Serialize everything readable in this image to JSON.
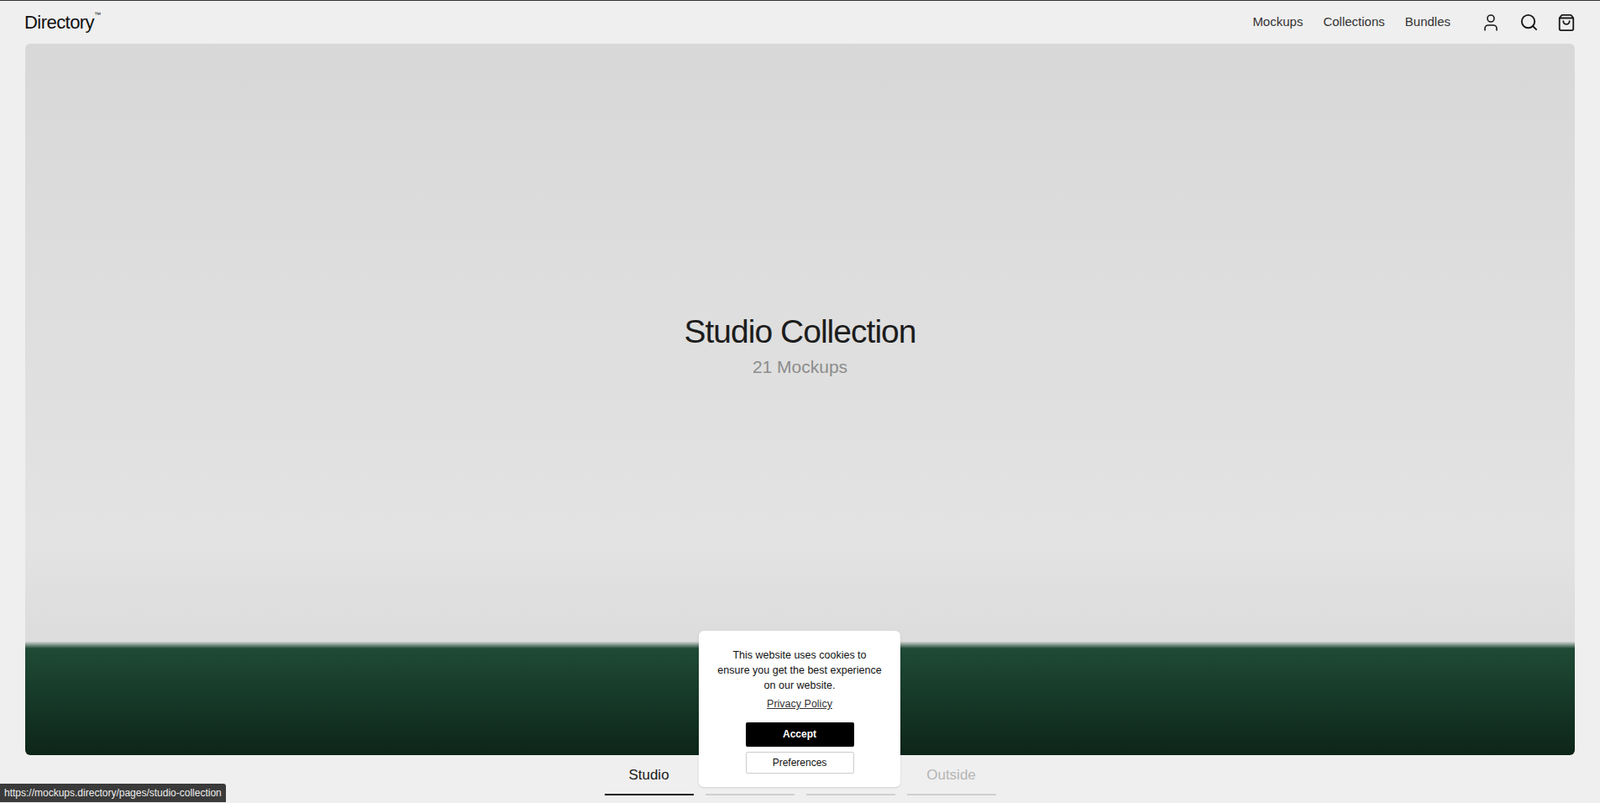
{
  "header": {
    "logo": "Directory",
    "logo_mark": "™",
    "nav": [
      "Mockups",
      "Collections",
      "Bundles"
    ]
  },
  "hero": {
    "title": "Studio Collection",
    "subtitle": "21 Mockups"
  },
  "tabs": [
    {
      "label": "Studio",
      "selected": true,
      "disabled": false
    },
    {
      "label": "",
      "selected": false,
      "disabled": false
    },
    {
      "label": "",
      "selected": false,
      "disabled": false
    },
    {
      "label": "Outside",
      "selected": false,
      "disabled": true
    }
  ],
  "cookie_dialog": {
    "message": "This website uses cookies to ensure you get the best experience on our website.",
    "link": "Privacy Policy",
    "buttons": [
      "Accept",
      "Preferences"
    ]
  },
  "status_bar": {
    "url": "https://mockups.directory/pages/studio-collection"
  }
}
